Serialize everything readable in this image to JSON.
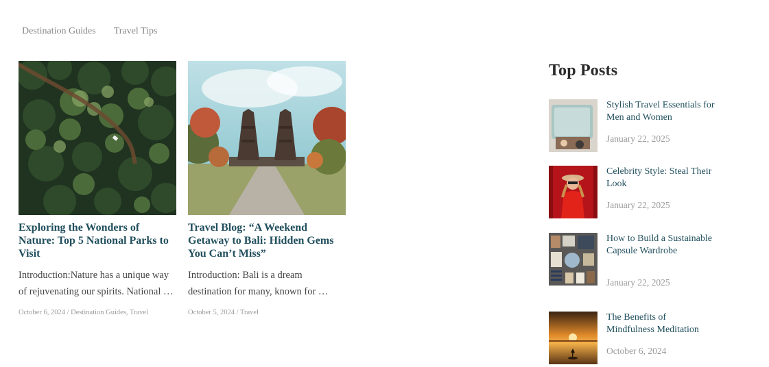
{
  "nav": {
    "items": [
      {
        "label": "Destination Guides"
      },
      {
        "label": "Travel Tips"
      }
    ]
  },
  "articles": [
    {
      "title": "Exploring the Wonders of Nature: Top 5 National Parks to Visit",
      "excerpt": "Introduction:Nature has a unique way of rejuvenating our spirits. National …",
      "date": "October 6, 2024",
      "separator": " / ",
      "categories": [
        "Destination Guides",
        "Travel"
      ],
      "image": "aerial-forest-road-photo"
    },
    {
      "title": "Travel Blog: “A Weekend Getaway to Bali: Hidden Gems You Can’t Miss”",
      "excerpt": "Introduction: Bali is a dream destination for many, known for …",
      "date": "October 5, 2024",
      "separator": " / ",
      "categories": [
        "Travel"
      ],
      "image": "bali-temple-gate-photo"
    }
  ],
  "sidebar": {
    "heading": "Top Posts",
    "posts": [
      {
        "title": "Stylish Travel Essentials for Men and Women",
        "date": "January 22, 2025",
        "image": "suitcase-photo"
      },
      {
        "title": "Celebrity Style: Steal Their Look",
        "date": "January 22, 2025",
        "image": "woman-red-dress-photo"
      },
      {
        "title": "How to Build a Sustainable Capsule Wardrobe",
        "date": "January 22, 2025",
        "image": "flatlay-clothes-photo"
      },
      {
        "title": "The Benefits of Mindfulness Meditation",
        "date": "October 6, 2024",
        "image": "sunset-meditation-photo"
      }
    ]
  },
  "colors": {
    "link": "#22505e",
    "muted": "#9a9a9a",
    "text": "#444444"
  }
}
